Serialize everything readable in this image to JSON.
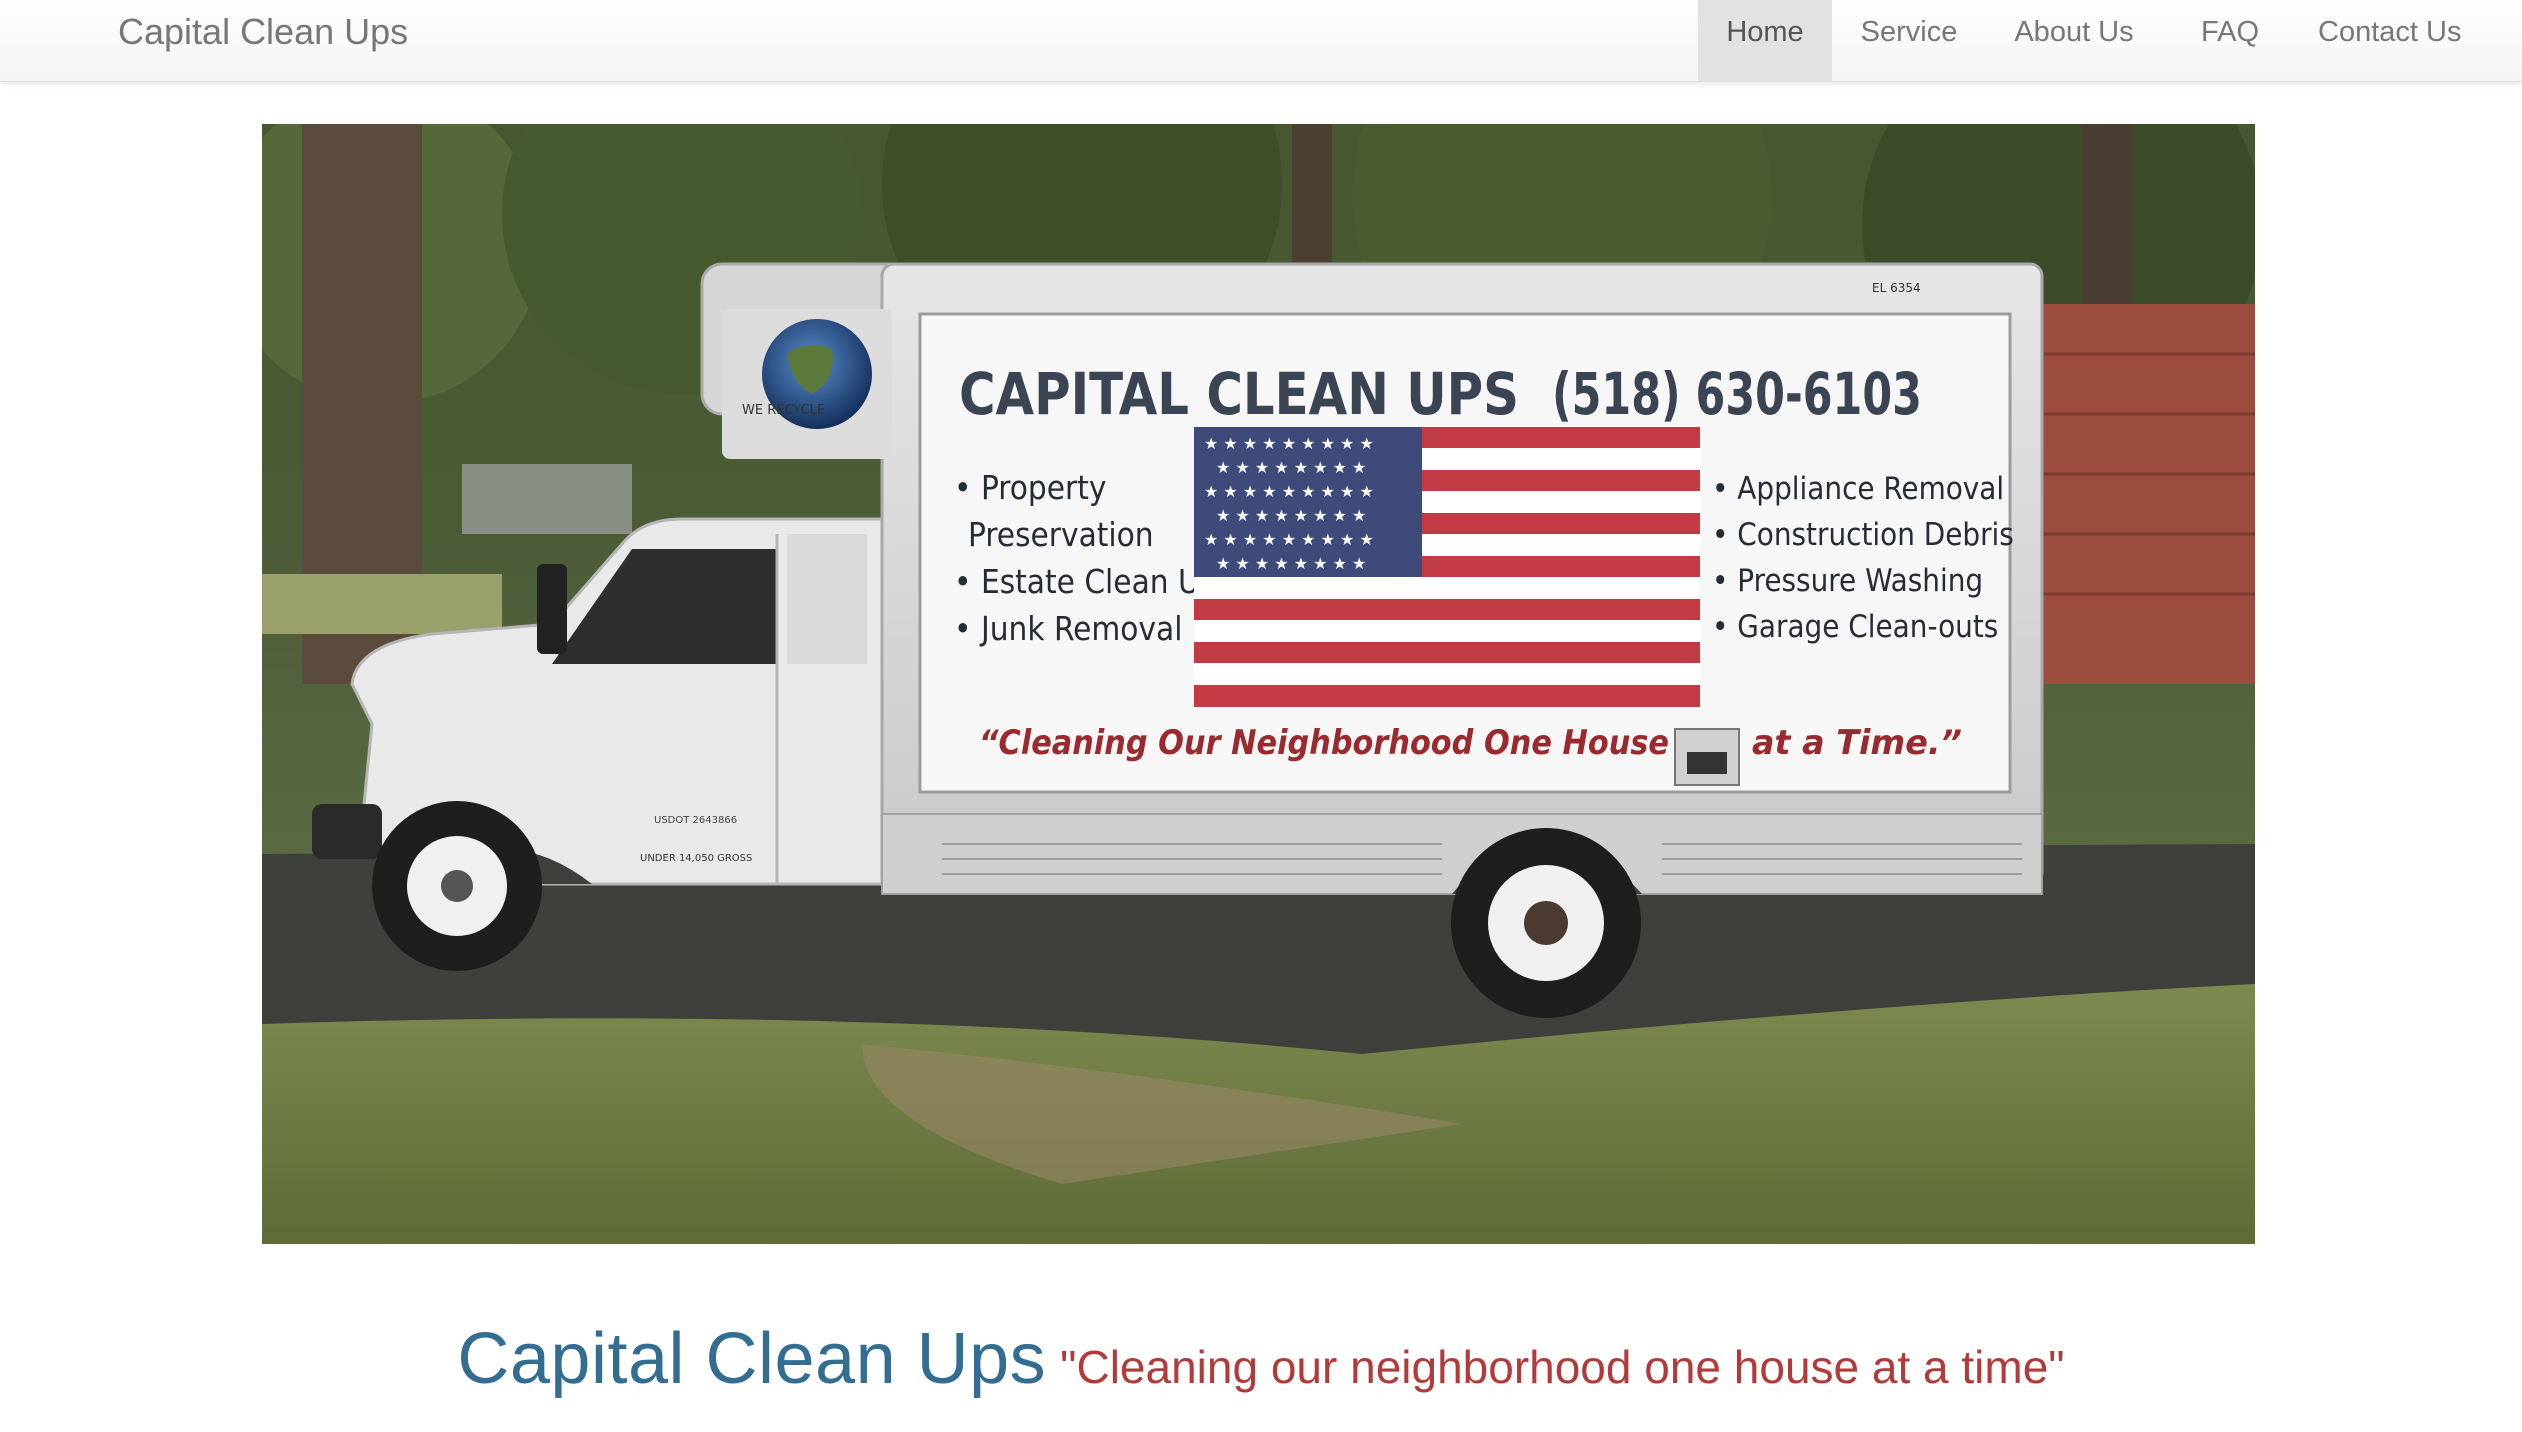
{
  "brand": "Capital Clean Ups",
  "nav": {
    "items": [
      "Home",
      "Service",
      "About Us",
      "FAQ",
      "Contact Us"
    ],
    "active": "Home"
  },
  "hero": {
    "truck": {
      "company": "CAPITAL CLEAN UPS",
      "phone": "(518) 630-6103",
      "services_left": [
        "• Property",
        "Preservation",
        "• Estate Clean Ups",
        "• Junk Removal"
      ],
      "services_right": [
        "• Appliance Removal",
        "• Construction Debris",
        "• Pressure Washing",
        "• Garage Clean-outs"
      ],
      "slogan_part1": "“Cleaning Our Neighborhood One House",
      "slogan_part2": "at a Time.”",
      "recycle_text": "WE RECYCLE",
      "box_id": "EL 6354",
      "usdot": "USDOT 2643866",
      "gross": "UNDER 14,050 GROSS"
    }
  },
  "heading": {
    "title": "Capital Clean Ups",
    "tagline": "\"Cleaning our neighborhood one house at a time\""
  },
  "colors": {
    "heading_blue": "#336d91",
    "tagline_red": "#b23a3a",
    "nav_active_bg": "#e2e2e2",
    "nav_text": "#777777"
  }
}
